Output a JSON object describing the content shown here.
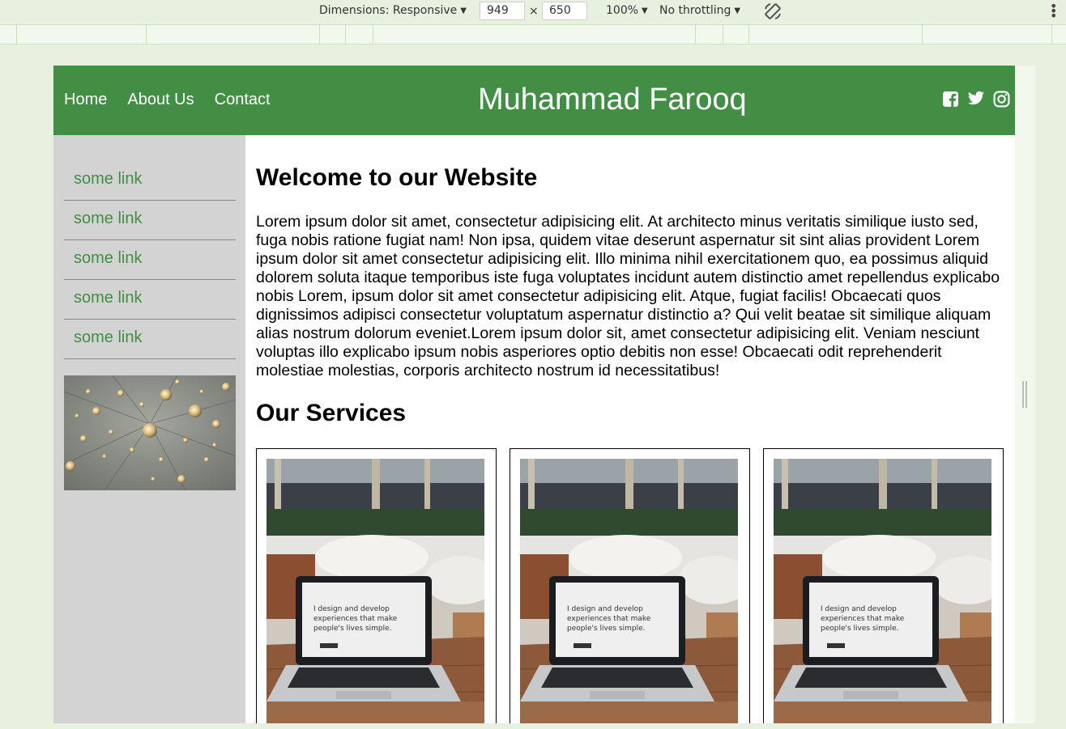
{
  "devtools": {
    "dimensions_label": "Dimensions: Responsive",
    "width_value": "949",
    "times_sign": "×",
    "height_value": "650",
    "zoom": "100%",
    "throttling": "No throttling",
    "rotate_icon": "rotate-icon",
    "more_icon": "more-vertical-icon"
  },
  "site": {
    "nav": [
      {
        "label": "Home"
      },
      {
        "label": "About Us"
      },
      {
        "label": "Contact"
      }
    ],
    "brand": "Muhammad Farooq",
    "socials": [
      "facebook-icon",
      "twitter-icon",
      "instagram-icon"
    ],
    "brand_color": "#428e44"
  },
  "sidebar": {
    "links": [
      {
        "label": "some link"
      },
      {
        "label": "some link"
      },
      {
        "label": "some link"
      },
      {
        "label": "some link"
      },
      {
        "label": "some link"
      }
    ]
  },
  "main": {
    "welcome_heading": "Welcome to our Website",
    "welcome_text": "Lorem ipsum dolor sit amet, consectetur adipisicing elit. At architecto minus veritatis similique iusto sed, fuga nobis ratione fugiat nam! Non ipsa, quidem vitae deserunt aspernatur sit sint alias provident Lorem ipsum dolor sit amet consectetur adipisicing elit. Illo minima nihil exercitationem quo, ea possimus aliquid dolorem soluta itaque temporibus iste fuga voluptates incidunt autem distinctio amet repellendus explicabo nobis Lorem, ipsum dolor sit amet consectetur adipisicing elit. Atque, fugiat facilis! Obcaecati quos dignissimos adipisci consectetur voluptatum aspernatur distinctio a? Qui velit beatae sit similique aliquam alias nostrum dolorum eveniet.Lorem ipsum dolor sit, amet consectetur adipisicing elit. Veniam nesciunt voluptas illo explicabo ipsum nobis asperiores optio debitis non esse! Obcaecati odit reprehenderit molestiae molestias, corporis architecto nostrum id necessitatibus!",
    "services_heading": "Our Services",
    "cards": [
      {
        "laptop_text_1": "I design and develop",
        "laptop_text_2": "experiences that make",
        "laptop_text_3": "people's lives simple."
      },
      {
        "laptop_text_1": "I design and develop",
        "laptop_text_2": "experiences that make",
        "laptop_text_3": "people's lives simple."
      },
      {
        "laptop_text_1": "I design and develop",
        "laptop_text_2": "experiences that make",
        "laptop_text_3": "people's lives simple."
      }
    ]
  }
}
